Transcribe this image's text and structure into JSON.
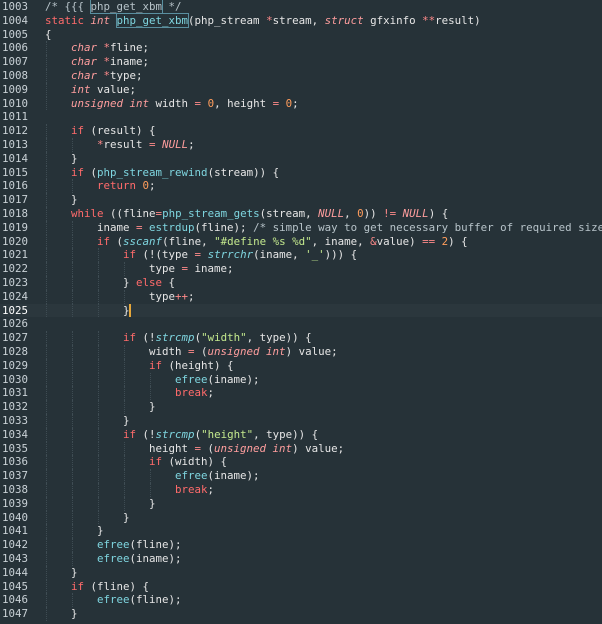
{
  "editor": {
    "language": "C",
    "cursor_line": "1025",
    "colors": {
      "background": "#263238",
      "keyword": "#ff6b6b",
      "type": "#ff9e9e",
      "function": "#7fd6e0",
      "string": "#c3e88d",
      "number": "#ff9d5c",
      "comment": "#b7c3c9",
      "cursor": "#e6a73a"
    },
    "lines": [
      {
        "num": "1003",
        "tokens": [
          [
            "cm",
            "/* {{{ "
          ],
          [
            "cm boxed",
            "php_get_xbm"
          ],
          [
            "cm",
            " */"
          ]
        ]
      },
      {
        "num": "1004",
        "tokens": [
          [
            "kw",
            "static "
          ],
          [
            "ty",
            "int "
          ],
          [
            "fn boxed",
            "php_get_xbm"
          ],
          [
            "pl",
            "(php_stream "
          ],
          [
            "op",
            "*"
          ],
          [
            "pl",
            "stream, "
          ],
          [
            "ty",
            "struct "
          ],
          [
            "pl",
            "gfxinfo "
          ],
          [
            "op",
            "**"
          ],
          [
            "pl",
            "result)"
          ]
        ]
      },
      {
        "num": "1005",
        "tokens": [
          [
            "pl",
            "{"
          ]
        ]
      },
      {
        "num": "1006",
        "tokens": [
          [
            "pl",
            "    "
          ],
          [
            "ty",
            "char "
          ],
          [
            "op",
            "*"
          ],
          [
            "pl",
            "fline;"
          ]
        ]
      },
      {
        "num": "1007",
        "tokens": [
          [
            "pl",
            "    "
          ],
          [
            "ty",
            "char "
          ],
          [
            "op",
            "*"
          ],
          [
            "pl",
            "iname;"
          ]
        ]
      },
      {
        "num": "1008",
        "tokens": [
          [
            "pl",
            "    "
          ],
          [
            "ty",
            "char "
          ],
          [
            "op",
            "*"
          ],
          [
            "pl",
            "type;"
          ]
        ]
      },
      {
        "num": "1009",
        "tokens": [
          [
            "pl",
            "    "
          ],
          [
            "ty",
            "int "
          ],
          [
            "pl",
            "value;"
          ]
        ]
      },
      {
        "num": "1010",
        "tokens": [
          [
            "pl",
            "    "
          ],
          [
            "ty",
            "unsigned int "
          ],
          [
            "pl",
            "width "
          ],
          [
            "op",
            "= "
          ],
          [
            "nu",
            "0"
          ],
          [
            "pl",
            ", height "
          ],
          [
            "op",
            "= "
          ],
          [
            "nu",
            "0"
          ],
          [
            "pl",
            ";"
          ]
        ]
      },
      {
        "num": "1011",
        "tokens": []
      },
      {
        "num": "1012",
        "tokens": [
          [
            "pl",
            "    "
          ],
          [
            "kw",
            "if "
          ],
          [
            "pl",
            "(result) {"
          ]
        ]
      },
      {
        "num": "1013",
        "tokens": [
          [
            "pl",
            "        "
          ],
          [
            "op",
            "*"
          ],
          [
            "pl",
            "result "
          ],
          [
            "op",
            "= "
          ],
          [
            "nl",
            "NULL"
          ],
          [
            "pl",
            ";"
          ]
        ]
      },
      {
        "num": "1014",
        "tokens": [
          [
            "pl",
            "    }"
          ]
        ]
      },
      {
        "num": "1015",
        "tokens": [
          [
            "pl",
            "    "
          ],
          [
            "kw",
            "if "
          ],
          [
            "pl",
            "("
          ],
          [
            "fn",
            "php_stream_rewind"
          ],
          [
            "pl",
            "(stream)) {"
          ]
        ]
      },
      {
        "num": "1016",
        "tokens": [
          [
            "pl",
            "        "
          ],
          [
            "kw",
            "return "
          ],
          [
            "nu",
            "0"
          ],
          [
            "pl",
            ";"
          ]
        ]
      },
      {
        "num": "1017",
        "tokens": [
          [
            "pl",
            "    }"
          ]
        ]
      },
      {
        "num": "1018",
        "tokens": [
          [
            "pl",
            "    "
          ],
          [
            "kw",
            "while "
          ],
          [
            "pl",
            "((fline"
          ],
          [
            "op",
            "="
          ],
          [
            "fn",
            "php_stream_gets"
          ],
          [
            "pl",
            "(stream, "
          ],
          [
            "nl",
            "NULL"
          ],
          [
            "pl",
            ", "
          ],
          [
            "nu",
            "0"
          ],
          [
            "pl",
            ")) "
          ],
          [
            "op",
            "!= "
          ],
          [
            "nl",
            "NULL"
          ],
          [
            "pl",
            ") {"
          ]
        ]
      },
      {
        "num": "1019",
        "tokens": [
          [
            "pl",
            "        iname "
          ],
          [
            "op",
            "= "
          ],
          [
            "fn",
            "estrdup"
          ],
          [
            "pl",
            "(fline); "
          ],
          [
            "cm",
            "/* simple way to get necessary buffer of required size */"
          ]
        ]
      },
      {
        "num": "1020",
        "tokens": [
          [
            "pl",
            "        "
          ],
          [
            "kw",
            "if "
          ],
          [
            "pl",
            "("
          ],
          [
            "fni",
            "sscanf"
          ],
          [
            "pl",
            "(fline, "
          ],
          [
            "st",
            "\"#define %s %d\""
          ],
          [
            "pl",
            ", iname, "
          ],
          [
            "op",
            "&"
          ],
          [
            "pl",
            "value) "
          ],
          [
            "op",
            "== "
          ],
          [
            "nu",
            "2"
          ],
          [
            "pl",
            ") {"
          ]
        ]
      },
      {
        "num": "1021",
        "tokens": [
          [
            "pl",
            "            "
          ],
          [
            "kw",
            "if "
          ],
          [
            "pl",
            "(!(type "
          ],
          [
            "op",
            "= "
          ],
          [
            "fni",
            "strrchr"
          ],
          [
            "pl",
            "(iname, "
          ],
          [
            "st",
            "'_'"
          ],
          [
            "pl",
            "))) {"
          ]
        ]
      },
      {
        "num": "1022",
        "tokens": [
          [
            "pl",
            "                type "
          ],
          [
            "op",
            "= "
          ],
          [
            "pl",
            "iname;"
          ]
        ]
      },
      {
        "num": "1023",
        "tokens": [
          [
            "pl",
            "            } "
          ],
          [
            "kw",
            "else "
          ],
          [
            "pl",
            "{"
          ]
        ]
      },
      {
        "num": "1024",
        "tokens": [
          [
            "pl",
            "                type"
          ],
          [
            "op",
            "++"
          ],
          [
            "pl",
            ";"
          ]
        ]
      },
      {
        "num": "1025",
        "tokens": [
          [
            "pl",
            "            }"
          ]
        ]
      },
      {
        "num": "1026",
        "tokens": []
      },
      {
        "num": "1027",
        "tokens": [
          [
            "pl",
            "            "
          ],
          [
            "kw",
            "if "
          ],
          [
            "pl",
            "(!"
          ],
          [
            "fni",
            "strcmp"
          ],
          [
            "pl",
            "("
          ],
          [
            "st",
            "\"width\""
          ],
          [
            "pl",
            ", type)) {"
          ]
        ]
      },
      {
        "num": "1028",
        "tokens": [
          [
            "pl",
            "                width "
          ],
          [
            "op",
            "= "
          ],
          [
            "pl",
            "("
          ],
          [
            "ty",
            "unsigned int"
          ],
          [
            "pl",
            ") value;"
          ]
        ]
      },
      {
        "num": "1029",
        "tokens": [
          [
            "pl",
            "                "
          ],
          [
            "kw",
            "if "
          ],
          [
            "pl",
            "(height) {"
          ]
        ]
      },
      {
        "num": "1030",
        "tokens": [
          [
            "pl",
            "                    "
          ],
          [
            "fn",
            "efree"
          ],
          [
            "pl",
            "(iname);"
          ]
        ]
      },
      {
        "num": "1031",
        "tokens": [
          [
            "pl",
            "                    "
          ],
          [
            "kw",
            "break"
          ],
          [
            "pl",
            ";"
          ]
        ]
      },
      {
        "num": "1032",
        "tokens": [
          [
            "pl",
            "                }"
          ]
        ]
      },
      {
        "num": "1033",
        "tokens": [
          [
            "pl",
            "            }"
          ]
        ]
      },
      {
        "num": "1034",
        "tokens": [
          [
            "pl",
            "            "
          ],
          [
            "kw",
            "if "
          ],
          [
            "pl",
            "(!"
          ],
          [
            "fni",
            "strcmp"
          ],
          [
            "pl",
            "("
          ],
          [
            "st",
            "\"height\""
          ],
          [
            "pl",
            ", type)) {"
          ]
        ]
      },
      {
        "num": "1035",
        "tokens": [
          [
            "pl",
            "                height "
          ],
          [
            "op",
            "= "
          ],
          [
            "pl",
            "("
          ],
          [
            "ty",
            "unsigned int"
          ],
          [
            "pl",
            ") value;"
          ]
        ]
      },
      {
        "num": "1036",
        "tokens": [
          [
            "pl",
            "                "
          ],
          [
            "kw",
            "if "
          ],
          [
            "pl",
            "(width) {"
          ]
        ]
      },
      {
        "num": "1037",
        "tokens": [
          [
            "pl",
            "                    "
          ],
          [
            "fn",
            "efree"
          ],
          [
            "pl",
            "(iname);"
          ]
        ]
      },
      {
        "num": "1038",
        "tokens": [
          [
            "pl",
            "                    "
          ],
          [
            "kw",
            "break"
          ],
          [
            "pl",
            ";"
          ]
        ]
      },
      {
        "num": "1039",
        "tokens": [
          [
            "pl",
            "                }"
          ]
        ]
      },
      {
        "num": "1040",
        "tokens": [
          [
            "pl",
            "            }"
          ]
        ]
      },
      {
        "num": "1041",
        "tokens": [
          [
            "pl",
            "        }"
          ]
        ]
      },
      {
        "num": "1042",
        "tokens": [
          [
            "pl",
            "        "
          ],
          [
            "fn",
            "efree"
          ],
          [
            "pl",
            "(fline);"
          ]
        ]
      },
      {
        "num": "1043",
        "tokens": [
          [
            "pl",
            "        "
          ],
          [
            "fn",
            "efree"
          ],
          [
            "pl",
            "(iname);"
          ]
        ]
      },
      {
        "num": "1044",
        "tokens": [
          [
            "pl",
            "    }"
          ]
        ]
      },
      {
        "num": "1045",
        "tokens": [
          [
            "pl",
            "    "
          ],
          [
            "kw",
            "if "
          ],
          [
            "pl",
            "(fline) {"
          ]
        ]
      },
      {
        "num": "1046",
        "tokens": [
          [
            "pl",
            "        "
          ],
          [
            "fn",
            "efree"
          ],
          [
            "pl",
            "(fline);"
          ]
        ]
      },
      {
        "num": "1047",
        "tokens": [
          [
            "pl",
            "    }"
          ]
        ]
      }
    ]
  }
}
